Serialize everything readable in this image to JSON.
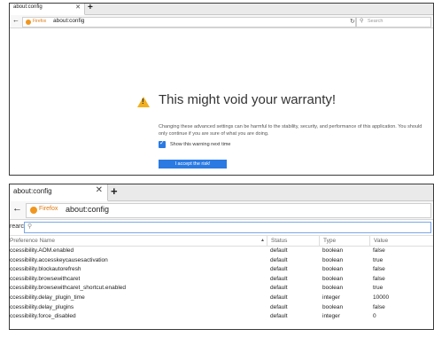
{
  "warning_window": {
    "tab_title": "about:config",
    "firefox_label": "Firefox",
    "url": "about:config",
    "search_placeholder": "Search",
    "heading": "This might void your warranty!",
    "body": "Changing these advanced settings can be harmful to the stability, security, and performance of this application. You should only continue if you are sure of what you are doing.",
    "checkbox_label": "Show this warning next time",
    "checkbox_checked": true,
    "accept_button": "I accept the risk!",
    "accent_color": "#2a7ae2",
    "warning_color": "#f2b01e"
  },
  "config_window": {
    "tab_title": "about:config",
    "firefox_label": "Firefox",
    "url": "about:config",
    "search_label": "rearch:",
    "columns": [
      "Preference Name",
      "Status",
      "Type",
      "Value"
    ],
    "rows": [
      {
        "name": "ccessibility.AOM.enabled",
        "status": "default",
        "type": "boolean",
        "value": "false"
      },
      {
        "name": "ccessibility.accesskeycausesactivation",
        "status": "default",
        "type": "boolean",
        "value": "true"
      },
      {
        "name": "ccessibility.blockautorefresh",
        "status": "default",
        "type": "boolean",
        "value": "false"
      },
      {
        "name": "ccessibility.browsewithcaret",
        "status": "default",
        "type": "boolean",
        "value": "false"
      },
      {
        "name": "ccessibility.browsewithcaret_shortcut.enabled",
        "status": "default",
        "type": "boolean",
        "value": "true"
      },
      {
        "name": "ccessibility.delay_plugin_time",
        "status": "default",
        "type": "integer",
        "value": "10000"
      },
      {
        "name": "ccessibility.delay_plugins",
        "status": "default",
        "type": "boolean",
        "value": "false"
      },
      {
        "name": "ccessibility.force_disabled",
        "status": "default",
        "type": "integer",
        "value": "0"
      }
    ]
  }
}
